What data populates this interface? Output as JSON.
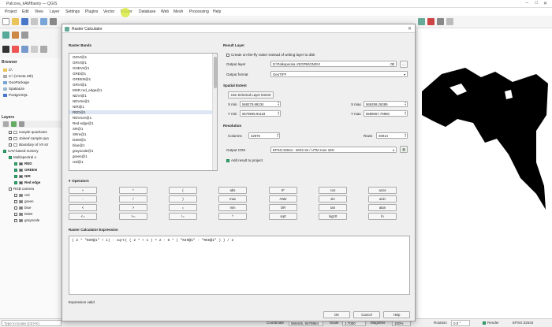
{
  "app": {
    "title": "Palcova_kAMfbanty — QGIS",
    "menus": [
      "Project",
      "Edit",
      "View",
      "Layer",
      "Settings",
      "Plugins",
      "Vector",
      "Raster",
      "Database",
      "Web",
      "Mesh",
      "Processing",
      "Help"
    ]
  },
  "browser": {
    "title": "Browser",
    "items": [
      "C\\",
      "C:\\ (Vmeta Sth)",
      "GeoPackage",
      "SpatiaLite",
      "PostgreSQL"
    ]
  },
  "layers": {
    "title": "Layers",
    "items": [
      {
        "label": "sample quadrants",
        "indent": 1,
        "checked": false,
        "italic": true,
        "swatch": "#ffffff"
      },
      {
        "label": "Joined sample qua",
        "indent": 1,
        "checked": false,
        "italic": true,
        "swatch": "#ffffff"
      },
      {
        "label": "Boundary of VII str",
        "indent": 1,
        "checked": false,
        "italic": true,
        "swatch": "#ffffff"
      },
      {
        "label": "UAV-based nursery",
        "indent": 0,
        "checked": true,
        "italic": false,
        "swatch": ""
      },
      {
        "label": "Multispectral o",
        "indent": 1,
        "checked": true,
        "italic": false,
        "swatch": ""
      },
      {
        "label": "RED",
        "indent": 2,
        "checked": true,
        "italic": false,
        "bold": true,
        "swatch": "#555555"
      },
      {
        "label": "GREEN",
        "indent": 2,
        "checked": true,
        "italic": false,
        "bold": true,
        "swatch": "#555555"
      },
      {
        "label": "NIR",
        "indent": 2,
        "checked": true,
        "italic": false,
        "bold": true,
        "swatch": "#555555"
      },
      {
        "label": "Red edge",
        "indent": 2,
        "checked": true,
        "italic": false,
        "bold": true,
        "swatch": "#555555"
      },
      {
        "label": "RGB camera",
        "indent": 1,
        "checked": false,
        "italic": false,
        "swatch": ""
      },
      {
        "label": "red",
        "indent": 2,
        "checked": false,
        "italic": false,
        "swatch": "#777777"
      },
      {
        "label": "green",
        "indent": 2,
        "checked": false,
        "italic": false,
        "swatch": "#777777"
      },
      {
        "label": "blue",
        "indent": 2,
        "checked": false,
        "italic": false,
        "swatch": "#777777"
      },
      {
        "label": "DSM",
        "indent": 2,
        "checked": false,
        "italic": false,
        "swatch": "#777777"
      },
      {
        "label": "grayscale",
        "indent": 2,
        "checked": false,
        "italic": false,
        "swatch": "#777777"
      }
    ]
  },
  "dialog": {
    "title": "Raster Calculator",
    "bands_title": "Raster Bands",
    "bands": [
      "GDVI@1",
      "GRVI@1",
      "GNDVI@1",
      "GRD@1",
      "GREEN@1",
      "GRVI@1",
      "MSR red_edge@1",
      "NDVI@1",
      "NDVIre@1",
      "NIR@1",
      "RED@1",
      "RDVIcre@1",
      "Red edge@1",
      "SR@1",
      "SRre@1",
      "DSM@1",
      "blue@1",
      "grayscale@1",
      "green@1",
      "red@1"
    ],
    "selected_band_index": 10,
    "result_layer": {
      "title": "Result Layer",
      "create_on_fly_label": "Create on-the-fly raster instead of writing layer to disk",
      "output_layer_label": "Output layer",
      "output_layer_value": "D:\\Palkopera\\a VEGPM\\GNDVI",
      "output_format_label": "Output format",
      "output_format_value": "GeoTIFF"
    },
    "extent": {
      "title": "Spatial Extent",
      "use_selected_label": "Use Selected Layer Extent",
      "xmin_label": "X min",
      "xmin_value": "569279.99234",
      "xmax_label": "X max",
      "xmax_value": "569299.26389",
      "ymin_label": "Y min",
      "ymin_value": "6579595.91118",
      "ymax_label": "Y max",
      "ymax_value": "6589657.79860"
    },
    "resolution": {
      "title": "Resolution",
      "columns_label": "Columns",
      "columns_value": "22976",
      "rows_label": "Rows",
      "rows_value": "26914"
    },
    "output_crs_label": "Output CRS",
    "output_crs_value": "EPSG:32634 - WGS 84 / UTM zone 34N",
    "add_result_label": "Add result to project",
    "operators_title": "Operators",
    "operators": [
      [
        "+",
        "*",
        "(",
        "abs",
        "IF",
        "cos",
        "acos"
      ],
      [
        "-",
        "/",
        ")",
        "max",
        "AND",
        "sin",
        "asin"
      ],
      [
        "<",
        ">",
        "=",
        "min",
        "OR",
        "tan",
        "atan"
      ],
      [
        "<=",
        ">=",
        "!=",
        "^",
        "sqrt",
        "log10",
        "ln"
      ]
    ],
    "expression_title": "Raster Calculator Expression",
    "expression": "( 2 * \"NIR@1\" + 1) - sqrt( ( 2 * + 1 ) ^ 2 - 8 * ( \"NIR@1\" - \"RED@1\" ) ) / 2",
    "expression_status": "Expression valid",
    "buttons": {
      "ok": "OK",
      "cancel": "Cancel",
      "help": "Help"
    }
  },
  "statusbar": {
    "search_placeholder": "Type to locate (Ctrl+K)",
    "coordinate_label": "Coordinate",
    "coordinate_value": "569445, 6579954",
    "scale_label": "Scale",
    "scale_value": "1:7000",
    "magnifier_label": "Magnifier",
    "magnifier_value": "100%",
    "rotation_label": "Rotation",
    "rotation_value": "0.0 °",
    "render_label": "Render",
    "crs_value": "EPSG:32634"
  },
  "colors": {
    "accent": "#2e7d32",
    "selection": "#dde6f3",
    "map_fill": "#000000"
  }
}
